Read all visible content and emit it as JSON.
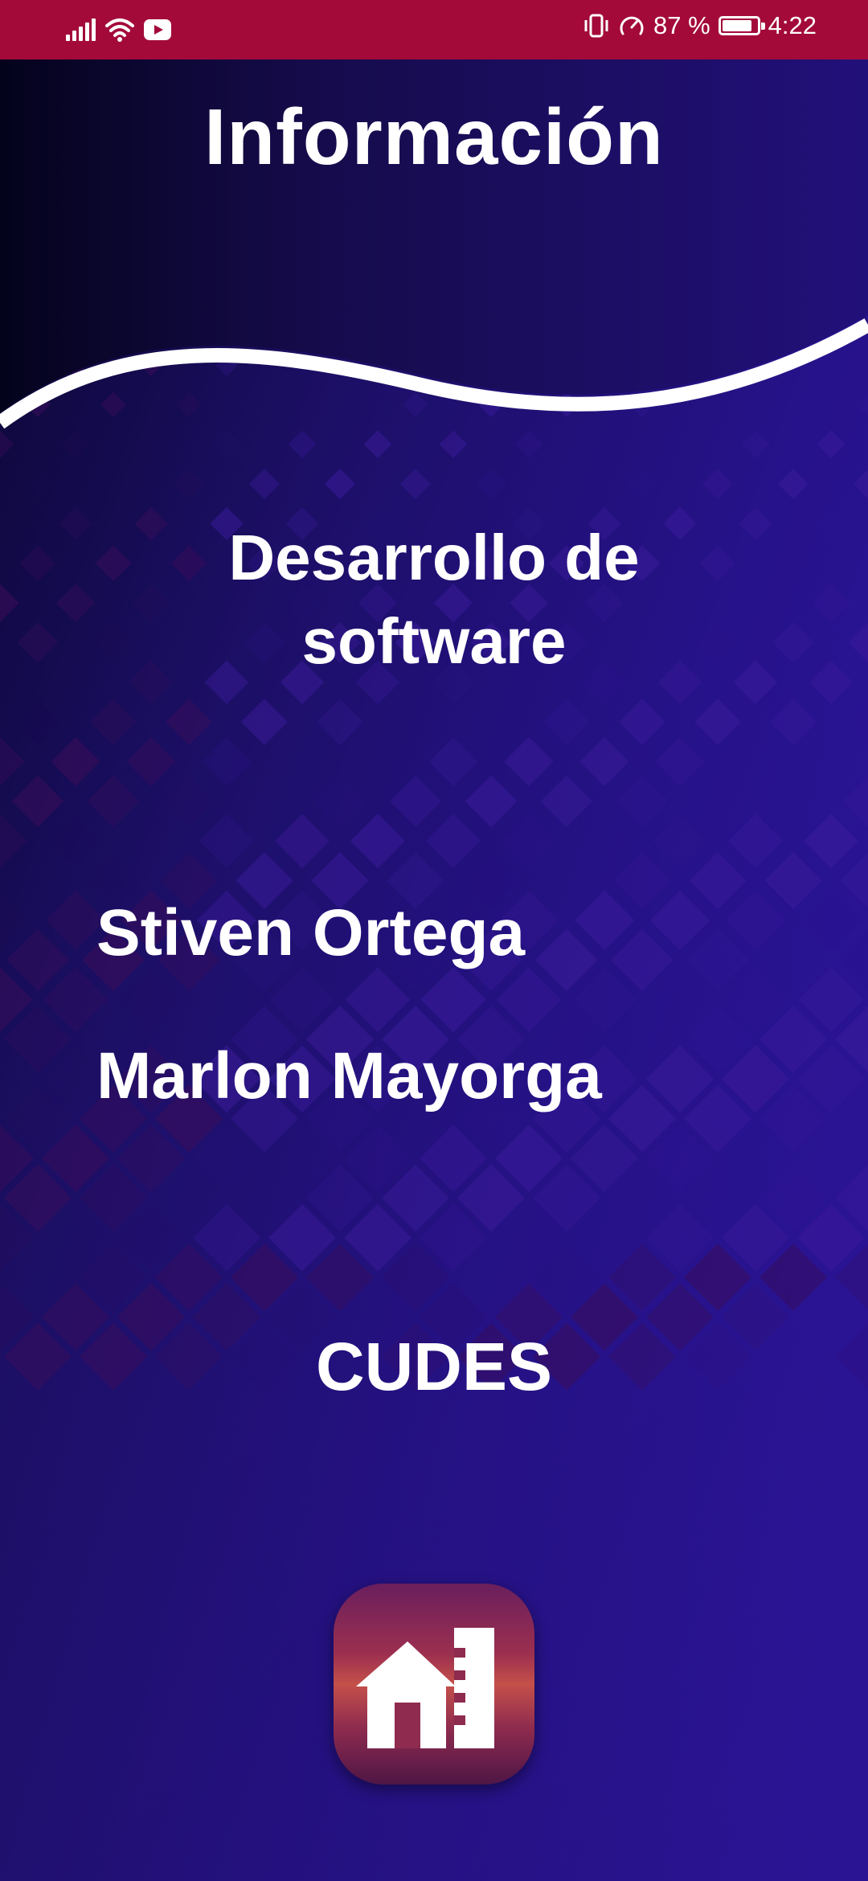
{
  "status_bar": {
    "battery_percent": "87 %",
    "battery_level": 0.87,
    "time": "4:22",
    "icons": [
      "signal-icon",
      "wifi-icon",
      "youtube-icon",
      "vibrate-icon",
      "data-saver-icon",
      "battery-icon"
    ]
  },
  "header": {
    "title": "Información"
  },
  "content": {
    "subtitle_line1": "Desarrollo de",
    "subtitle_line2": "software",
    "names": [
      "Stiven Ortega",
      "Marlon Mayorga"
    ],
    "organization": "CUDES"
  },
  "logo": {
    "icon": "house-building-icon"
  },
  "colors": {
    "status_bar": "#a30a3a",
    "background_dark": "#0a0630",
    "background_accent": "#2f16a8",
    "text": "#ffffff"
  }
}
